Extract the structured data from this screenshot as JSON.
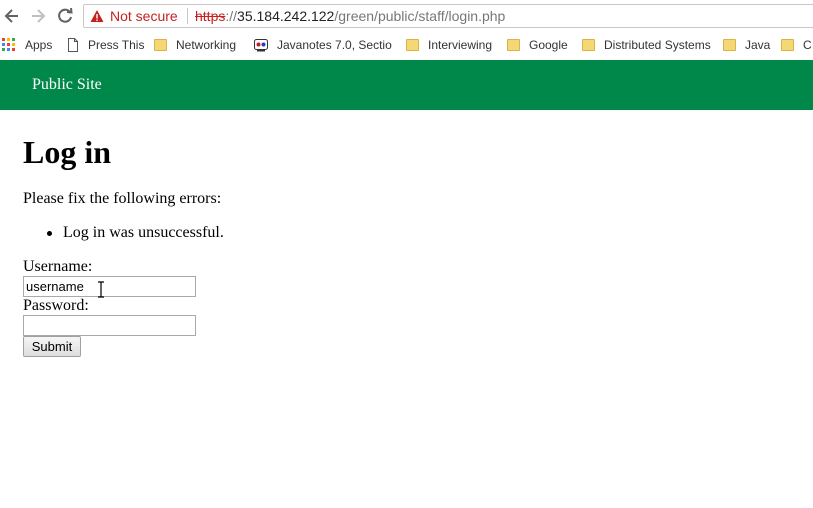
{
  "browser": {
    "security_label": "Not secure",
    "url": {
      "scheme": "https",
      "separator": "://",
      "host": "35.184.242.122",
      "path": "/green/public/staff/login.php"
    },
    "bookmarks": [
      {
        "label": "Apps",
        "icon": "apps-grid-icon"
      },
      {
        "label": "Press This",
        "icon": "page-icon"
      },
      {
        "label": "Networking",
        "icon": "folder-icon"
      },
      {
        "label": "Javanotes 7.0, Sectio",
        "icon": "javanotes-favicon-icon"
      },
      {
        "label": "Interviewing",
        "icon": "folder-icon"
      },
      {
        "label": "Google",
        "icon": "folder-icon"
      },
      {
        "label": "Distributed Systems",
        "icon": "folder-icon"
      },
      {
        "label": "Java",
        "icon": "folder-icon"
      },
      {
        "label": "C",
        "icon": "folder-icon"
      }
    ]
  },
  "header": {
    "title": "Public Site"
  },
  "main": {
    "heading": "Log in",
    "errors_intro": "Please fix the following errors:",
    "errors": [
      "Log in was unsuccessful."
    ],
    "username": {
      "label": "Username:",
      "value": "username"
    },
    "password": {
      "label": "Password:",
      "value": ""
    },
    "submit_label": "Submit"
  },
  "colors": {
    "header_bg": "#00884a",
    "not_secure_red": "#c5221f"
  }
}
